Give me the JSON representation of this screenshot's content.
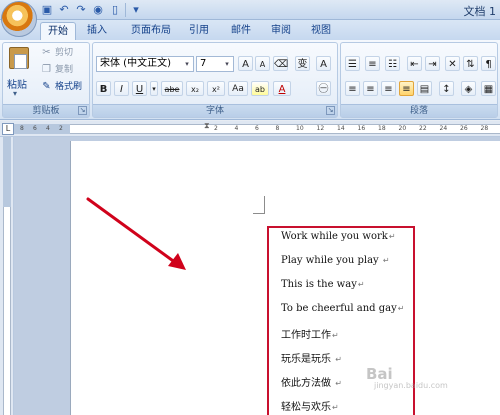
{
  "app": {
    "title": "文档 1"
  },
  "tabs": [
    {
      "label": "开始",
      "active": true
    },
    {
      "label": "插入"
    },
    {
      "label": "页面布局"
    },
    {
      "label": "引用"
    },
    {
      "label": "邮件"
    },
    {
      "label": "审阅"
    },
    {
      "label": "视图"
    }
  ],
  "clipboard": {
    "group_label": "剪贴板",
    "paste": "粘贴",
    "cut": "剪切",
    "copy": "复制",
    "format_painter": "格式刷"
  },
  "font": {
    "group_label": "字体",
    "name": "宋体 (中文正文)",
    "size": "7",
    "grow": "A",
    "shrink": "A",
    "special": "变",
    "bold": "B",
    "italic": "I",
    "underline": "U",
    "strike": "abe",
    "subscript": "x₂",
    "superscript": "x²",
    "case": "Aa",
    "highlight": "ab",
    "font_color": "A",
    "boxed": "A"
  },
  "paragraph": {
    "group_label": "段落"
  },
  "ruler": {
    "numbers": [
      "8",
      "6",
      "4",
      "2",
      "2",
      "4",
      "6",
      "8",
      "10",
      "12",
      "14",
      "16",
      "18",
      "20",
      "22",
      "24",
      "26",
      "28",
      "30",
      "32",
      "34",
      "36",
      "38"
    ]
  },
  "document": {
    "lines": [
      {
        "text": "Work while you work",
        "mark": "↵"
      },
      {
        "text": "Play while you play ",
        "mark": "↵"
      },
      {
        "text": "This is the way",
        "mark": "↵"
      },
      {
        "text": "To be cheerful and gay",
        "mark": "↵"
      },
      {
        "text": "工作时工作",
        "mark": "↵"
      },
      {
        "text": "玩乐是玩乐 ",
        "mark": "↵"
      },
      {
        "text": "依此方法做 ",
        "mark": "↵"
      },
      {
        "text": "轻松与欢乐",
        "mark": "↵"
      }
    ]
  },
  "colors": {
    "highlight_box": "#c8102e",
    "arrow": "#d0021b",
    "accent": "#15428b"
  },
  "watermark": {
    "brand": "Bai",
    "sub": "jingyan.baidu.com"
  }
}
